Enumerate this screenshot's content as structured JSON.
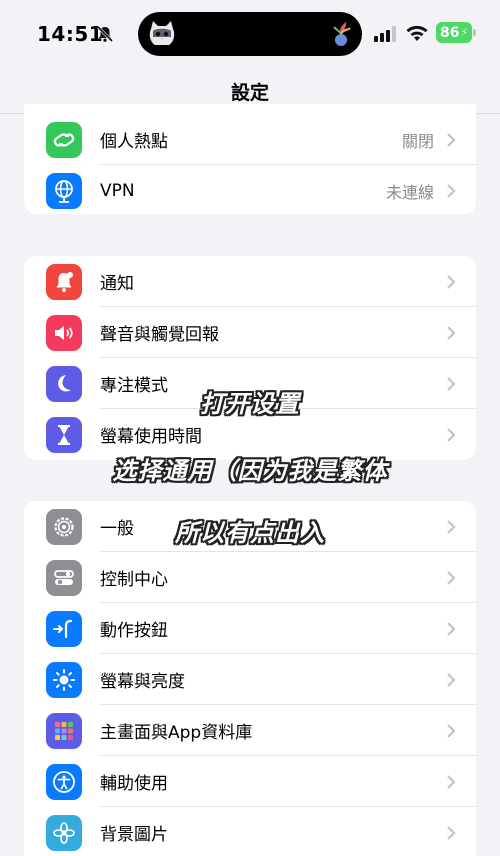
{
  "status": {
    "time": "14:51",
    "battery": "86"
  },
  "header": {
    "title": "設定"
  },
  "group1": [
    {
      "label": "個人熱點",
      "value": "關閉",
      "icon": "hotspot-icon",
      "color": "#34c759"
    },
    {
      "label": "VPN",
      "value": "未連線",
      "icon": "vpn-globe-icon",
      "color": "#0a7aff"
    }
  ],
  "group2": [
    {
      "label": "通知",
      "icon": "bell-icon",
      "color": "#f2453d"
    },
    {
      "label": "聲音與觸覺回報",
      "icon": "speaker-icon",
      "color": "#f23b5c"
    },
    {
      "label": "專注模式",
      "icon": "moon-icon",
      "color": "#5e5ce6"
    },
    {
      "label": "螢幕使用時間",
      "icon": "hourglass-icon",
      "color": "#5e5ce6"
    }
  ],
  "group3": [
    {
      "label": "一般",
      "icon": "gear-icon",
      "color": "#8e8e93"
    },
    {
      "label": "控制中心",
      "icon": "toggles-icon",
      "color": "#8e8e93"
    },
    {
      "label": "動作按鈕",
      "icon": "action-button-icon",
      "color": "#0a7aff"
    },
    {
      "label": "螢幕與亮度",
      "icon": "sun-icon",
      "color": "#0a7aff"
    },
    {
      "label": "主畫面與App資料庫",
      "icon": "app-grid-icon",
      "color": "#5e5ce6"
    },
    {
      "label": "輔助使用",
      "icon": "accessibility-icon",
      "color": "#0a7aff"
    },
    {
      "label": "背景圖片",
      "icon": "flower-icon",
      "color": "#35aadc"
    }
  ],
  "captions": {
    "line1": "打开设置",
    "line2": "选择通用（因为我是繁体",
    "line3": "所以有点出入"
  }
}
